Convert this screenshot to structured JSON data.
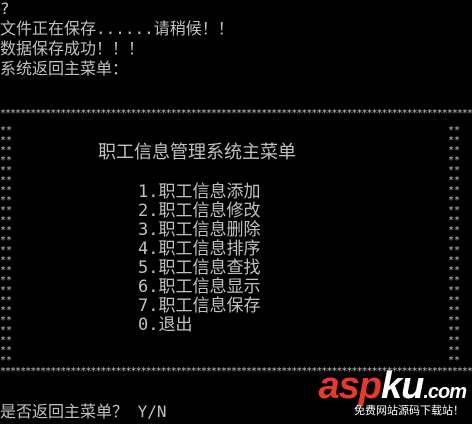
{
  "console": {
    "output_lines": [
      "?",
      "文件正在保存......请稍候！！",
      "数据保存成功！！！",
      "系统返回主菜单："
    ],
    "menu_title": "职工信息管理系统主菜单",
    "menu_items": [
      "1.职工信息添加",
      "2.职工信息修改",
      "3.职工信息删除",
      "4.职工信息排序",
      "5.职工信息查找",
      "6.职工信息显示",
      "7.职工信息保存",
      "0.退出"
    ],
    "prompt": "是否返回主菜单？ Y/N",
    "border_char": "*"
  },
  "watermark": {
    "logo_part1": "asp",
    "logo_part2": "ku",
    "logo_suffix": ".com",
    "subtitle": "免费网站源码下载站！"
  },
  "colors": {
    "background": "#000000",
    "text": "#c0c0c0",
    "watermark_red": "#e8392a"
  }
}
